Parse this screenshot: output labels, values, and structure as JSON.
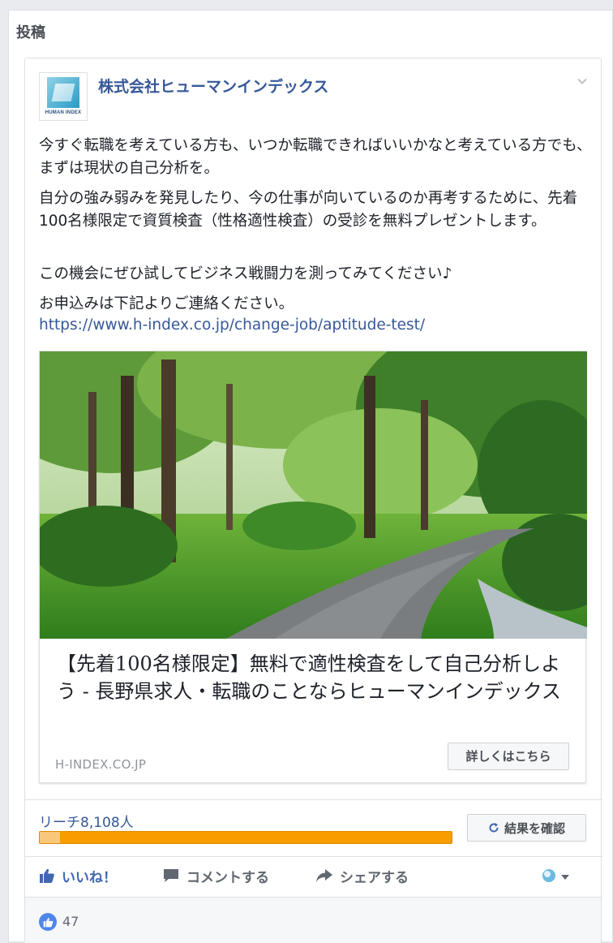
{
  "panel": {
    "title": "投稿"
  },
  "post": {
    "author": "株式会社ヒューマンインデックス",
    "avatar_text": "HUMAN INDEX",
    "paragraphs": [
      "今すぐ転職を考えている方も、いつか転職できればいいかなと考えている方でも、まずは現状の自己分析を。",
      "自分の強み弱みを発見したり、今の仕事が向いているのか再考するために、先着100名様限定で資質検査（性格適性検査）の受診を無料プレゼントします。",
      "この機会にぜひ試してビジネス戦闘力を測ってみてください♪",
      "お申込みは下記よりご連絡ください。"
    ],
    "link": "https://www.h-index.co.jp/change-job/aptitude-test/"
  },
  "link_card": {
    "headline": "【先着100名様限定】無料で適性検査をして自己分析しよう - 長野県求人・転職のことならヒューマンインデックス",
    "domain": "H-INDEX.CO.JP",
    "cta": "詳しくはこちら"
  },
  "stats": {
    "reach": "リーチ8,108人",
    "reach_organic_fraction": 0.05,
    "result_button": "結果を確認"
  },
  "actions": {
    "like": "いいね！",
    "comment": "コメントする",
    "share": "シェアする"
  },
  "reactions": {
    "like_count": "47"
  },
  "colors": {
    "link": "#365899",
    "like_blue": "#4267b2",
    "reach_paid": "#f79d00",
    "reach_organic": "#f8c77a"
  }
}
